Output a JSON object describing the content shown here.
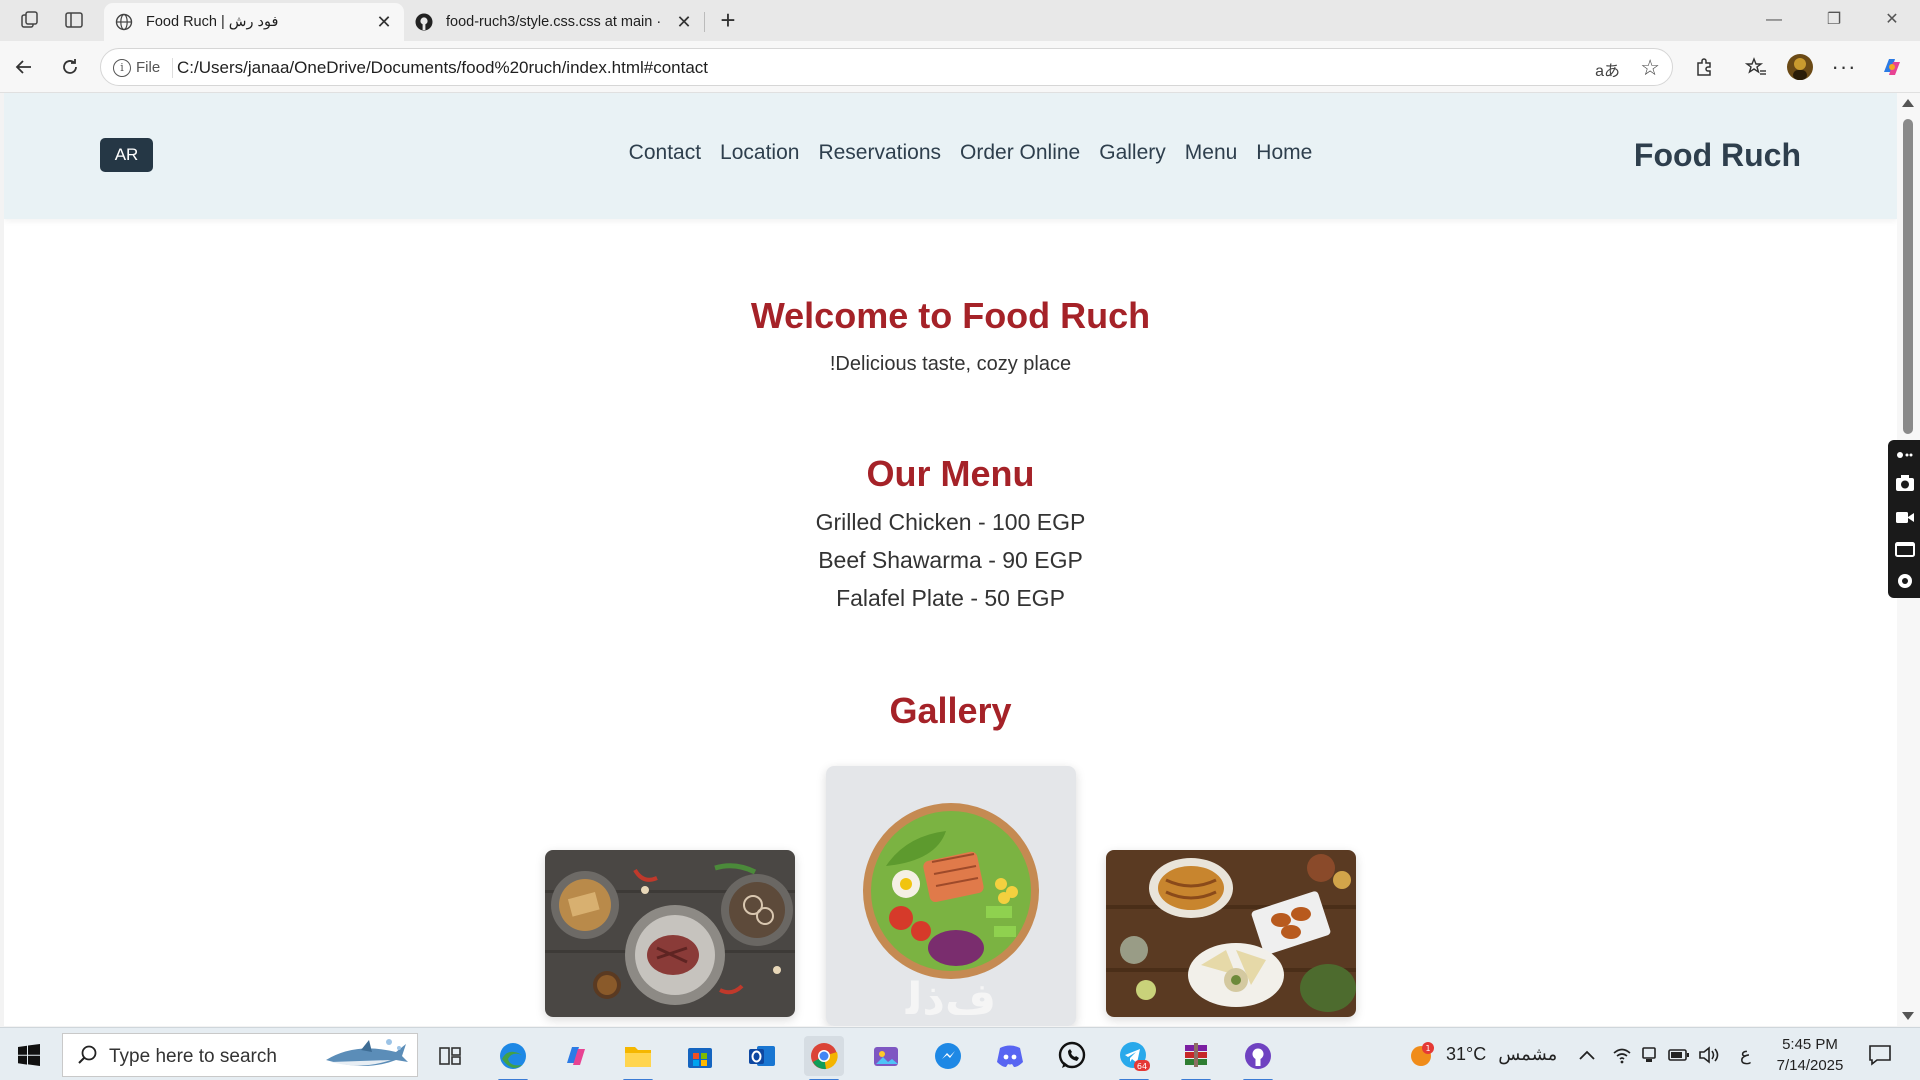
{
  "browser": {
    "tabs": [
      {
        "title": "Food Ruch | فود رش",
        "active": true
      },
      {
        "title": "food-ruch3/style.css.css at main ·",
        "active": false
      }
    ],
    "address": {
      "scheme_label": "File",
      "url": "C:/Users/janaa/OneDrive/Documents/food%20ruch/index.html#contact"
    },
    "read_aloud_label": "aあ"
  },
  "site": {
    "lang_button": "AR",
    "brand": "Food Ruch",
    "nav": [
      "Contact",
      "Location",
      "Reservations",
      "Order Online",
      "Gallery",
      "Menu",
      "Home"
    ],
    "hero": {
      "title": "Welcome to Food Ruch",
      "subtitle": "!Delicious taste, cozy place"
    },
    "menu": {
      "title": "Our Menu",
      "items": [
        "Grilled Chicken - 100 EGP",
        "Beef Shawarma - 90 EGP",
        "Falafel Plate - 50 EGP"
      ]
    },
    "gallery": {
      "title": "Gallery"
    },
    "colors": {
      "accent": "#a52228",
      "header_bg": "#e9f2f5",
      "dark": "#253745"
    }
  },
  "taskbar": {
    "search_placeholder": "Type here to search",
    "weather": {
      "temp": "31°C",
      "condition": "مشمس",
      "badge": "1"
    },
    "lang": "ع",
    "time": "5:45 PM",
    "date": "7/14/2025",
    "telegram_badge": "64"
  }
}
